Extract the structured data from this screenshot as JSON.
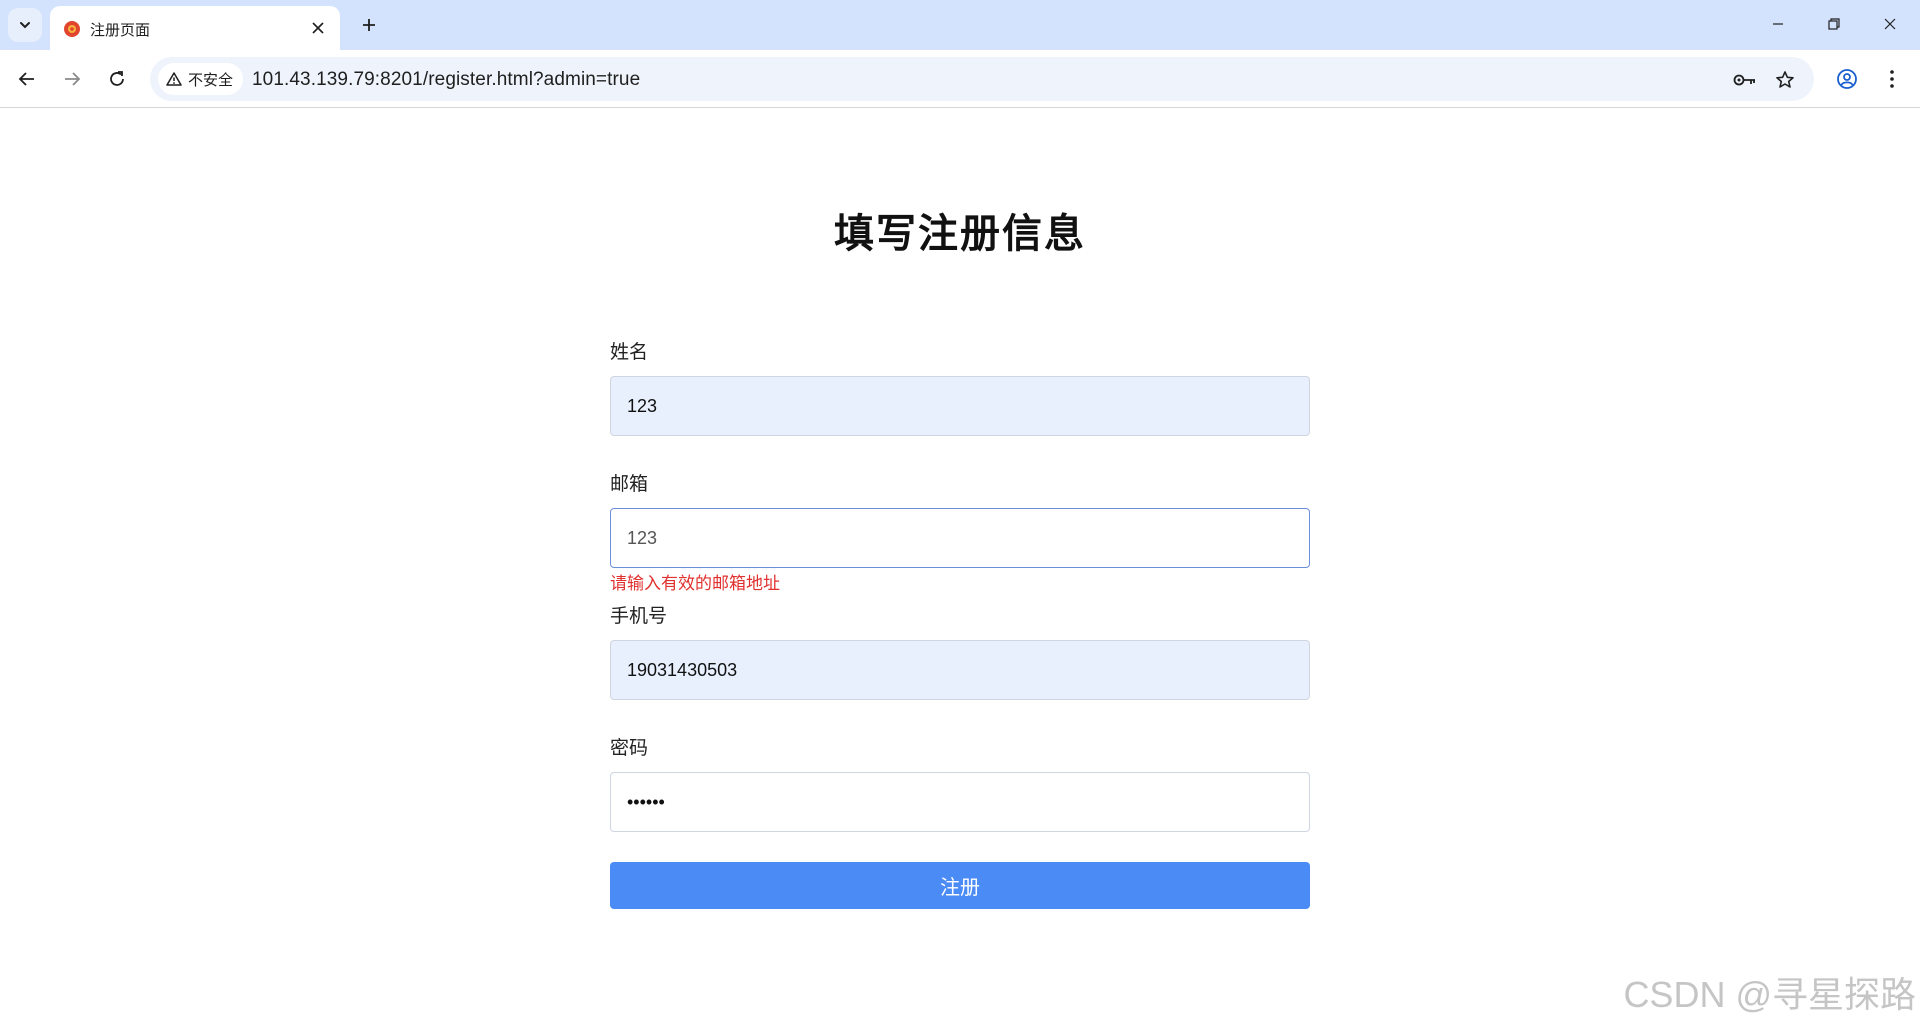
{
  "browser": {
    "tab": {
      "title": "注册页面"
    },
    "address_bar": {
      "security_label": "不安全",
      "url": "101.43.139.79:8201/register.html?admin=true"
    }
  },
  "form": {
    "title": "填写注册信息",
    "name": {
      "label": "姓名",
      "value": "123"
    },
    "email": {
      "label": "邮箱",
      "value": "123",
      "error": "请输入有效的邮箱地址"
    },
    "phone": {
      "label": "手机号",
      "value": "19031430503"
    },
    "password": {
      "label": "密码",
      "value": "123456"
    },
    "submit_label": "注册"
  },
  "watermark": "CSDN @寻星探路",
  "colors": {
    "accent": "#4a8bf5",
    "error": "#e0312f",
    "autofill": "#e8f0fe"
  }
}
